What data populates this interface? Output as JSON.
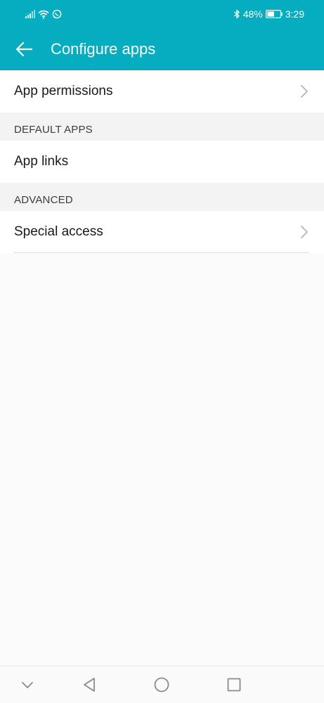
{
  "status_bar": {
    "battery_percent": "48%",
    "time": "3:29",
    "icons": [
      "signal-icon",
      "wifi-icon",
      "whatsapp-icon",
      "bluetooth-icon",
      "battery-icon"
    ]
  },
  "app_bar": {
    "title": "Configure apps",
    "back_icon": "arrow-left-icon"
  },
  "rows": {
    "app_permissions": "App permissions",
    "app_links": "App links",
    "special_access": "Special access"
  },
  "sections": {
    "default_apps": "DEFAULT APPS",
    "advanced": "ADVANCED"
  },
  "nav_bar": {
    "icons": [
      "chevron-down-icon",
      "back-triangle-icon",
      "home-circle-icon",
      "recents-square-icon"
    ]
  },
  "colors": {
    "accent": "#05adc1",
    "background": "#fbfbfb",
    "section_background": "#f3f3f3"
  }
}
